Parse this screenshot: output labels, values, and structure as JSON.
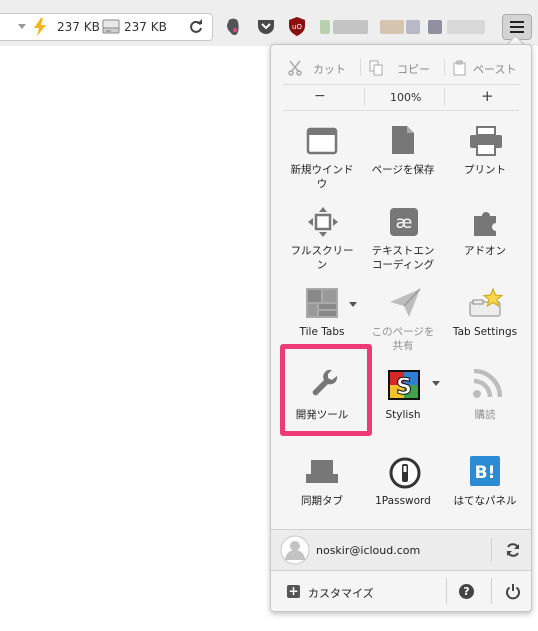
{
  "toolbar": {
    "download_size": "237 KB",
    "upload_size": "237 KB"
  },
  "edit": {
    "cut": "カット",
    "copy": "コピー",
    "paste": "ペースト"
  },
  "zoom": {
    "minus": "−",
    "level": "100%",
    "plus": "+"
  },
  "items": [
    {
      "label": "新規ウインド\nウ",
      "icon": "new-window-icon"
    },
    {
      "label": "ページを保存",
      "icon": "save-page-icon"
    },
    {
      "label": "プリント",
      "icon": "print-icon"
    },
    {
      "label": "フルスクリー\nン",
      "icon": "fullscreen-icon"
    },
    {
      "label": "テキストエン\nコーディング",
      "icon": "text-encoding-icon"
    },
    {
      "label": "アドオン",
      "icon": "addons-icon"
    },
    {
      "label": "Tile Tabs",
      "icon": "tile-tabs-icon"
    },
    {
      "label": "このページを\n共有",
      "icon": "share-icon"
    },
    {
      "label": "Tab Settings",
      "icon": "tab-settings-icon"
    },
    {
      "label": "開発ツール",
      "icon": "wrench-icon"
    },
    {
      "label": "Stylish",
      "icon": "stylish-icon"
    },
    {
      "label": "購読",
      "icon": "rss-icon"
    },
    {
      "label": "同期タブ",
      "icon": "synced-tabs-icon"
    },
    {
      "label": "1Password",
      "icon": "1password-icon"
    },
    {
      "label": "はてなパネル",
      "icon": "hatena-icon"
    }
  ],
  "account": {
    "email": "noskir@icloud.com"
  },
  "footer": {
    "customize": "カスタマイズ",
    "help_glyph": "?",
    "power_glyph": "⏻"
  },
  "colors": {
    "highlight": "#ee3b78",
    "hatena_blue": "#2b8bd5",
    "addon_lightning": "#f3b31b",
    "ublock_red": "#8b0f0f"
  }
}
